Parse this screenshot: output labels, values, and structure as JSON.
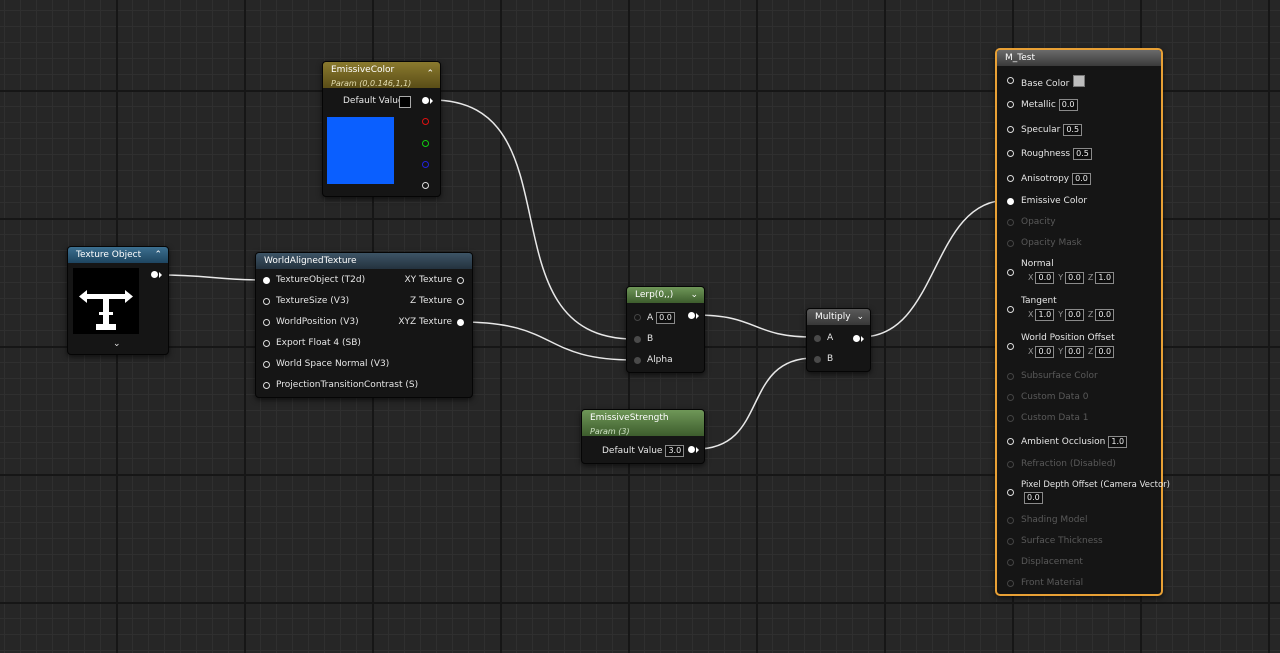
{
  "colors": {
    "accent_selected": "#e8a035",
    "emissive_swatch": "#0a5fff",
    "base_color_swatch": "#bdbdbd",
    "default_value_swatch": "#000000"
  },
  "texture_object": {
    "title": "Texture Object",
    "icon": "t-arrows-texture-icon"
  },
  "world_aligned": {
    "title": "WorldAlignedTexture",
    "inputs": [
      "TextureObject (T2d)",
      "TextureSize (V3)",
      "WorldPosition (V3)",
      "Export Float 4 (SB)",
      "World Space Normal (V3)",
      "ProjectionTransitionContrast (S)"
    ],
    "outputs": [
      "XY Texture",
      "Z Texture",
      "XYZ Texture"
    ]
  },
  "emissive_color": {
    "title": "EmissiveColor",
    "subtitle": "Param (0,0.146,1,1)",
    "default_label": "Default Value"
  },
  "lerp": {
    "title": "Lerp(0,,)",
    "input_a": "A",
    "a_value": "0.0",
    "input_b": "B",
    "input_alpha": "Alpha"
  },
  "emissive_strength": {
    "title": "EmissiveStrength",
    "subtitle": "Param (3)",
    "default_label": "Default Value",
    "default_value": "3.0"
  },
  "multiply": {
    "title": "Multiply",
    "input_a": "A",
    "input_b": "B"
  },
  "result": {
    "title": "M_Test",
    "base_color": "Base Color",
    "metallic": "Metallic",
    "metallic_value": "0.0",
    "specular": "Specular",
    "specular_value": "0.5",
    "roughness": "Roughness",
    "roughness_value": "0.5",
    "anisotropy": "Anisotropy",
    "anisotropy_value": "0.0",
    "emissive": "Emissive Color",
    "opacity": "Opacity",
    "opacity_mask": "Opacity Mask",
    "normal": "Normal",
    "normal_x": "0.0",
    "normal_y": "0.0",
    "normal_z": "1.0",
    "tangent": "Tangent",
    "tangent_x": "1.0",
    "tangent_y": "0.0",
    "tangent_z": "0.0",
    "wpo": "World Position Offset",
    "wpo_x": "0.0",
    "wpo_y": "0.0",
    "wpo_z": "0.0",
    "subsurface": "Subsurface Color",
    "custom0": "Custom Data 0",
    "custom1": "Custom Data 1",
    "ao": "Ambient Occlusion",
    "ao_value": "1.0",
    "refraction": "Refraction (Disabled)",
    "pdo": "Pixel Depth Offset (Camera Vector)",
    "pdo_value": "0.0",
    "shading_model": "Shading Model",
    "surface_thickness": "Surface Thickness",
    "displacement": "Displacement",
    "front_material": "Front Material"
  }
}
